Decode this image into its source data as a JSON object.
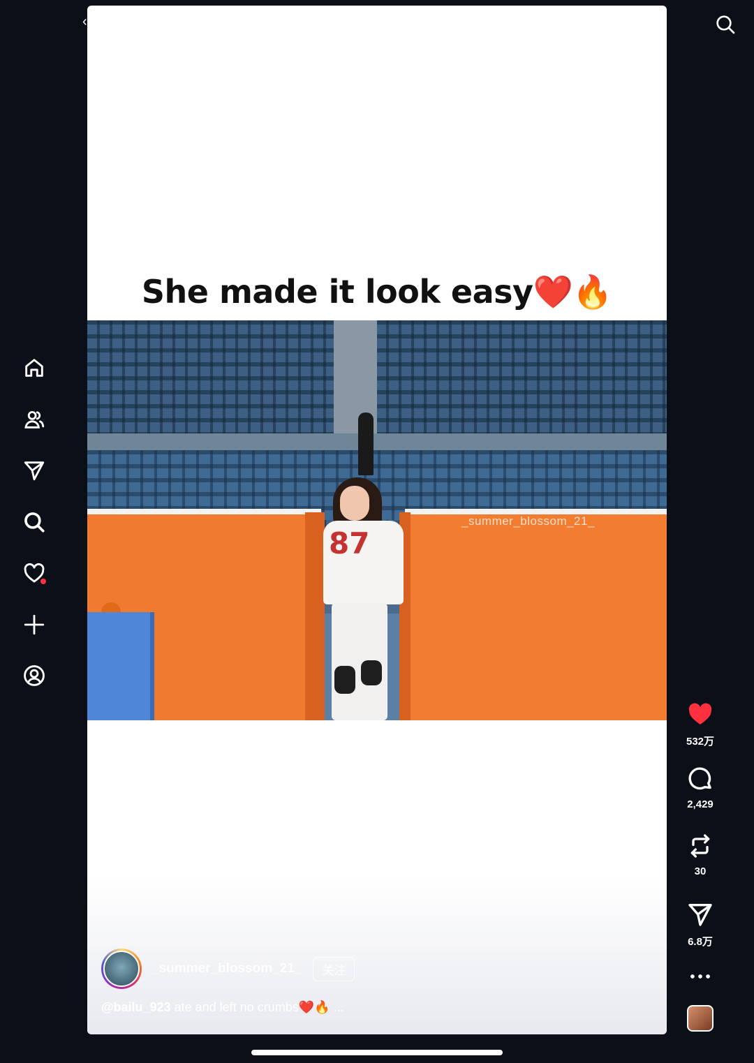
{
  "video": {
    "caption_text": "She made it look easy",
    "caption_emojis": "❤️🔥",
    "watermark": "_summer_blossom_21_",
    "jersey_number": "87"
  },
  "post": {
    "author": "_summer_blossom_21_",
    "follow_label": "关注",
    "mention": "@bailu_923",
    "caption": " ate and left no crumbs❤️🔥 ..."
  },
  "actions": {
    "likes": "532万",
    "comments": "2,429",
    "reposts": "30",
    "shares": "6.8万"
  },
  "sidebar": {
    "items": [
      "home-icon",
      "friends-icon",
      "send-icon",
      "search-icon",
      "heart-icon",
      "create-icon",
      "profile-icon"
    ]
  },
  "colors": {
    "background": "#0b0f17",
    "like_red": "#ff3040",
    "wall_orange": "#f27d30"
  }
}
